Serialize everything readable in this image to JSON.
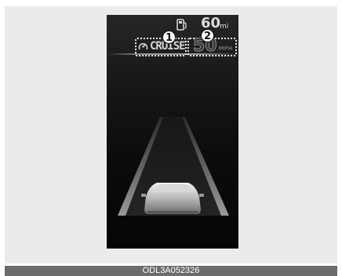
{
  "display": {
    "cruise_label": "CRUISE",
    "set_speed": "50",
    "set_speed_unit": "MPH",
    "range_value": "60",
    "range_unit": "mi",
    "callouts": [
      "1",
      "2"
    ]
  },
  "icons": {
    "cruise": "cruise-control-icon",
    "fuel": "fuel-pump-icon",
    "vehicle": "vehicle-icon"
  },
  "colors": {
    "display_bg": "#0c0c0c",
    "indicator": "#d6d6d6",
    "inactive_speed": "#3a3a3a",
    "caption_bg": "#6b6b6b"
  },
  "caption": "ODL3A052326"
}
